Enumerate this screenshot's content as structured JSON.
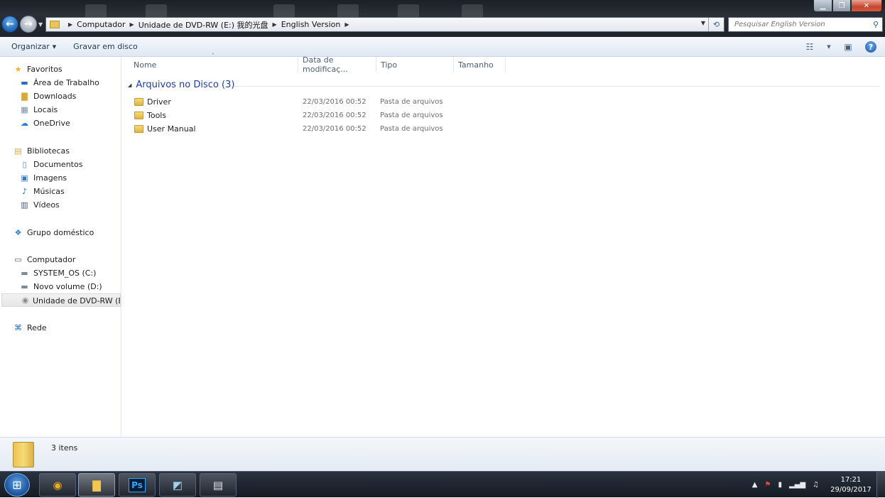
{
  "address": {
    "crumbs": [
      "Computador",
      "Unidade de DVD-RW (E:) 我的光盘",
      "English Version"
    ]
  },
  "search": {
    "placeholder": "Pesquisar English Version"
  },
  "toolbar": {
    "organize": "Organizar",
    "burn": "Gravar em disco"
  },
  "nav": {
    "favorites": "Favoritos",
    "desktop": "Área de Trabalho",
    "downloads": "Downloads",
    "places": "Locais",
    "onedrive": "OneDrive",
    "libraries": "Bibliotecas",
    "documents": "Documentos",
    "images": "Imagens",
    "music": "Músicas",
    "videos": "Vídeos",
    "homegroup": "Grupo doméstico",
    "computer": "Computador",
    "drive_c": "SYSTEM_OS (C:)",
    "drive_d": "Novo volume (D:)",
    "drive_e": "Unidade de DVD-RW (E:) 我的光盘",
    "network": "Rede"
  },
  "columns": {
    "name": "Nome",
    "date": "Data de modificaç...",
    "type": "Tipo",
    "size": "Tamanho"
  },
  "group": {
    "title": "Arquivos no Disco (3)"
  },
  "files": [
    {
      "name": "Driver",
      "date": "22/03/2016 00:52",
      "type": "Pasta de arquivos"
    },
    {
      "name": "Tools",
      "date": "22/03/2016 00:52",
      "type": "Pasta de arquivos"
    },
    {
      "name": "User Manual",
      "date": "22/03/2016 00:52",
      "type": "Pasta de arquivos"
    }
  ],
  "status": {
    "count": "3 itens"
  },
  "clock": {
    "time": "17:21",
    "date": "29/09/2017"
  },
  "colors": {
    "group_header": "#1e3ca8",
    "toolbar_text": "#1e3957"
  }
}
